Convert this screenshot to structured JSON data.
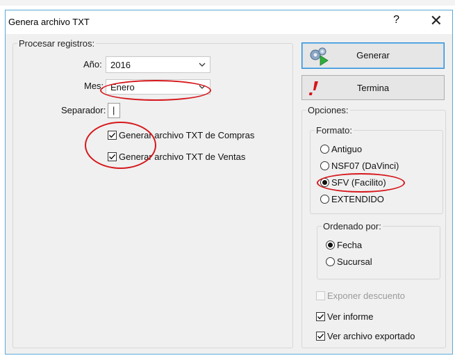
{
  "window": {
    "title": "Genera archivo TXT",
    "help_glyph": "?",
    "close_glyph": "✕"
  },
  "procesar": {
    "legend": "Procesar registros:",
    "anio_label": "Año:",
    "anio_value": "2016",
    "mes_label": "Mes:",
    "mes_value": "Enero",
    "separador_label": "Separador:",
    "separador_value": "|",
    "chk_compras": {
      "label": "Generar archivo TXT de Compras",
      "checked": true
    },
    "chk_ventas": {
      "label": "Generar archivo TXT de Ventas",
      "checked": true
    }
  },
  "buttons": {
    "generar": "Generar",
    "termina": "Termina"
  },
  "opciones": {
    "legend": "Opciones:",
    "formato": {
      "legend": "Formato:",
      "options": [
        "Antiguo",
        "NSF07 (DaVinci)",
        "SFV (Facilito)",
        "EXTENDIDO"
      ],
      "selected": "SFV (Facilito)"
    },
    "ordenado": {
      "legend": "Ordenado por:",
      "options": [
        "Fecha",
        "Sucursal"
      ],
      "selected": "Fecha"
    },
    "exponer_descuento": {
      "label": "Exponer descuento",
      "checked": false,
      "enabled": false
    },
    "ver_informe": {
      "label": "Ver informe",
      "checked": true
    },
    "ver_exportado": {
      "label": "Ver archivo exportado",
      "checked": true
    }
  },
  "colors": {
    "annotation": "#d6171b",
    "focus_border": "#2a8ad4",
    "dialog_bg": "#f0f0f0"
  }
}
